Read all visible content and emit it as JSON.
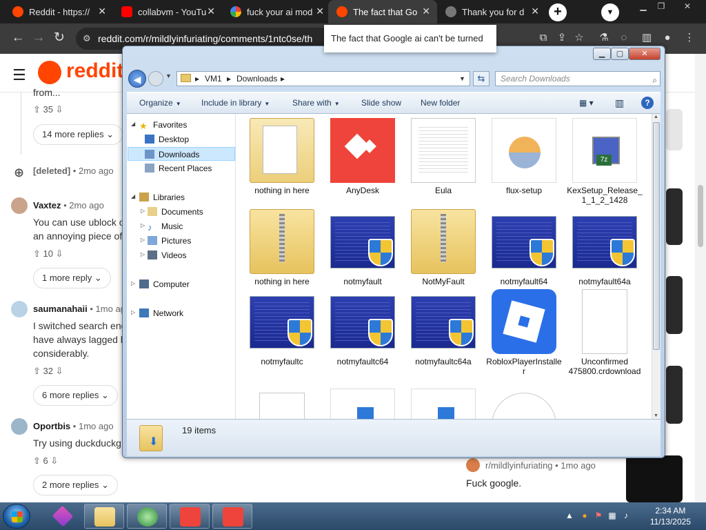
{
  "browser": {
    "tabs": [
      {
        "label": "Reddit - https://",
        "icon": "reddit-icon",
        "active": false
      },
      {
        "label": "collabvm - YouTu",
        "icon": "youtube-icon",
        "active": false
      },
      {
        "label": "fuck your ai mod",
        "icon": "google-icon",
        "active": false
      },
      {
        "label": "The fact that Go",
        "icon": "reddit-icon",
        "active": true
      },
      {
        "label": "Thank you for d",
        "icon": "globe-icon",
        "active": false
      }
    ],
    "new_tab": "+",
    "url": "reddit.com/r/mildlyinfuriating/comments/1ntc0se/th",
    "tooltip": "The fact that Google ai can't be turned"
  },
  "reddit": {
    "logo_text": "reddit",
    "comments": [
      {
        "text": "from...",
        "votes": "35",
        "more": "14 more replies"
      },
      {
        "user": "[deleted]",
        "time": "• 2mo ago"
      },
      {
        "user": "Vaxtez",
        "time": "• 2mo ago",
        "lines": [
          "You can use ublock o",
          "an annoying piece of"
        ],
        "votes": "10",
        "more": "1 more reply"
      },
      {
        "user": "saumanahaii",
        "time": "• 1mo ago",
        "lines": [
          "I switched search eng",
          "have always lagged b",
          "considerably."
        ],
        "votes": "32",
        "more": "6 more replies"
      },
      {
        "user": "Oportbis",
        "time": "• 1mo ago",
        "lines": [
          "Try using duckduckg"
        ],
        "votes": "6",
        "more": "2 more replies"
      }
    ],
    "subreddit_line": "r/mildlyinfuriating • 1mo ago",
    "bottom_comment": "Fuck google."
  },
  "explorer": {
    "address": [
      "VM1",
      "Downloads"
    ],
    "search_placeholder": "Search Downloads",
    "commands": [
      "Organize",
      "Include in library",
      "Share with",
      "Slide show",
      "New folder"
    ],
    "nav": {
      "favorites": "Favorites",
      "fav_items": [
        "Desktop",
        "Downloads",
        "Recent Places"
      ],
      "libraries": "Libraries",
      "lib_items": [
        "Documents",
        "Music",
        "Pictures",
        "Videos"
      ],
      "computer": "Computer",
      "network": "Network"
    },
    "files": [
      {
        "name": "nothing in here",
        "kind": "folder"
      },
      {
        "name": "AnyDesk",
        "kind": "anydesk"
      },
      {
        "name": "Eula",
        "kind": "doc"
      },
      {
        "name": "flux-setup",
        "kind": "flux"
      },
      {
        "name": "KexSetup_Release_1_1_2_1428",
        "kind": "kex"
      },
      {
        "name": "nothing in here",
        "kind": "zip"
      },
      {
        "name": "notmyfault",
        "kind": "bsod"
      },
      {
        "name": "NotMyFault",
        "kind": "zip"
      },
      {
        "name": "notmyfault64",
        "kind": "bsod"
      },
      {
        "name": "notmyfault64a",
        "kind": "bsod"
      },
      {
        "name": "notmyfaultc",
        "kind": "bsod"
      },
      {
        "name": "notmyfaultc64",
        "kind": "bsod"
      },
      {
        "name": "notmyfaultc64a",
        "kind": "bsod"
      },
      {
        "name": "RobloxPlayerInstaller",
        "kind": "roblox"
      },
      {
        "name": "Unconfirmed 475800.crdownload",
        "kind": "blank"
      }
    ],
    "status_count": "19 items"
  },
  "taskbar": {
    "time": "2:34 AM",
    "date": "11/13/2025"
  },
  "colors": {
    "reddit": "#ff4500",
    "anydesk": "#ef443b",
    "roblox": "#2b6fe8"
  }
}
